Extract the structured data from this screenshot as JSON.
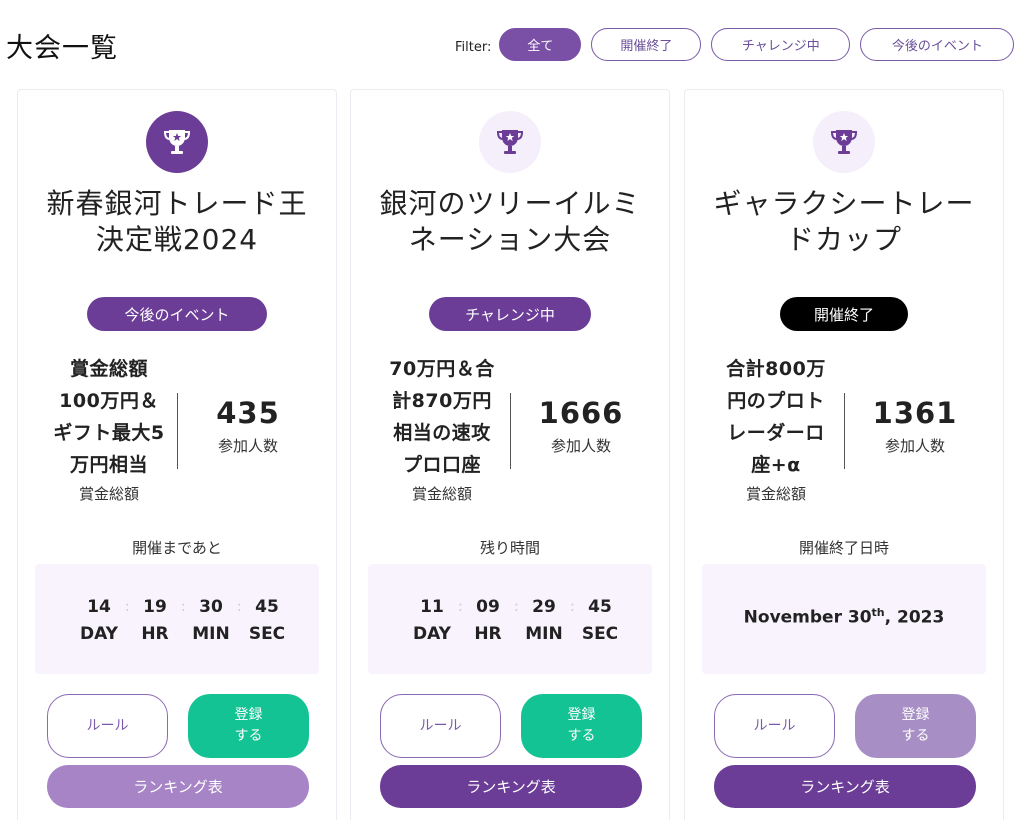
{
  "page": {
    "title": "大会一覧"
  },
  "filter": {
    "label": "Filter:",
    "options": [
      "全て",
      "開催終了",
      "チャレンジ中",
      "今後のイベント"
    ],
    "selected": "全て"
  },
  "colors": {
    "primary": "#6b3d96",
    "green": "#14c394",
    "black": "#000000"
  },
  "cards": [
    {
      "title_lines": [
        "新春銀河トレード王",
        "決定戦2024"
      ],
      "status": "今後のイベント",
      "prize_lines": [
        "賞金総額",
        "100万円＆",
        "ギフト最大5",
        "万円相当"
      ],
      "prize_label": "賞金総額",
      "participants": "435",
      "participants_label": "参加人数",
      "timer_caption": "開催まであと",
      "countdown": [
        {
          "value": "14",
          "unit": "DAY"
        },
        {
          "value": "19",
          "unit": "HR"
        },
        {
          "value": "30",
          "unit": "MIN"
        },
        {
          "value": "45",
          "unit": "SEC"
        }
      ],
      "rule_label": "ルール",
      "register_label": "登録する",
      "ranking_label": "ランキング表"
    },
    {
      "title_lines": [
        "銀河のツリーイルミ",
        "ネーション大会"
      ],
      "status": "チャレンジ中",
      "prize_lines": [
        "70万円＆合",
        "計870万円",
        "相当の速攻",
        "プロ口座"
      ],
      "prize_label": "賞金総額",
      "participants": "1666",
      "participants_label": "参加人数",
      "timer_caption": "残り時間",
      "countdown": [
        {
          "value": "11",
          "unit": "DAY"
        },
        {
          "value": "09",
          "unit": "HR"
        },
        {
          "value": "29",
          "unit": "MIN"
        },
        {
          "value": "45",
          "unit": "SEC"
        }
      ],
      "rule_label": "ルール",
      "register_label": "登録する",
      "ranking_label": "ランキング表"
    },
    {
      "title_lines": [
        "ギャラクシートレー",
        "ドカップ"
      ],
      "status": "開催終了",
      "prize_lines": [
        "合計800万",
        "円のプロト",
        "レーダーロ",
        "座+α"
      ],
      "prize_label": "賞金総額",
      "participants": "1361",
      "participants_label": "参加人数",
      "timer_caption": "開催終了日時",
      "end_date": {
        "month_day": "November 30",
        "suffix": "th",
        "year": ", 2023"
      },
      "rule_label": "ルール",
      "register_label": "登録する",
      "ranking_label": "ランキング表"
    }
  ]
}
